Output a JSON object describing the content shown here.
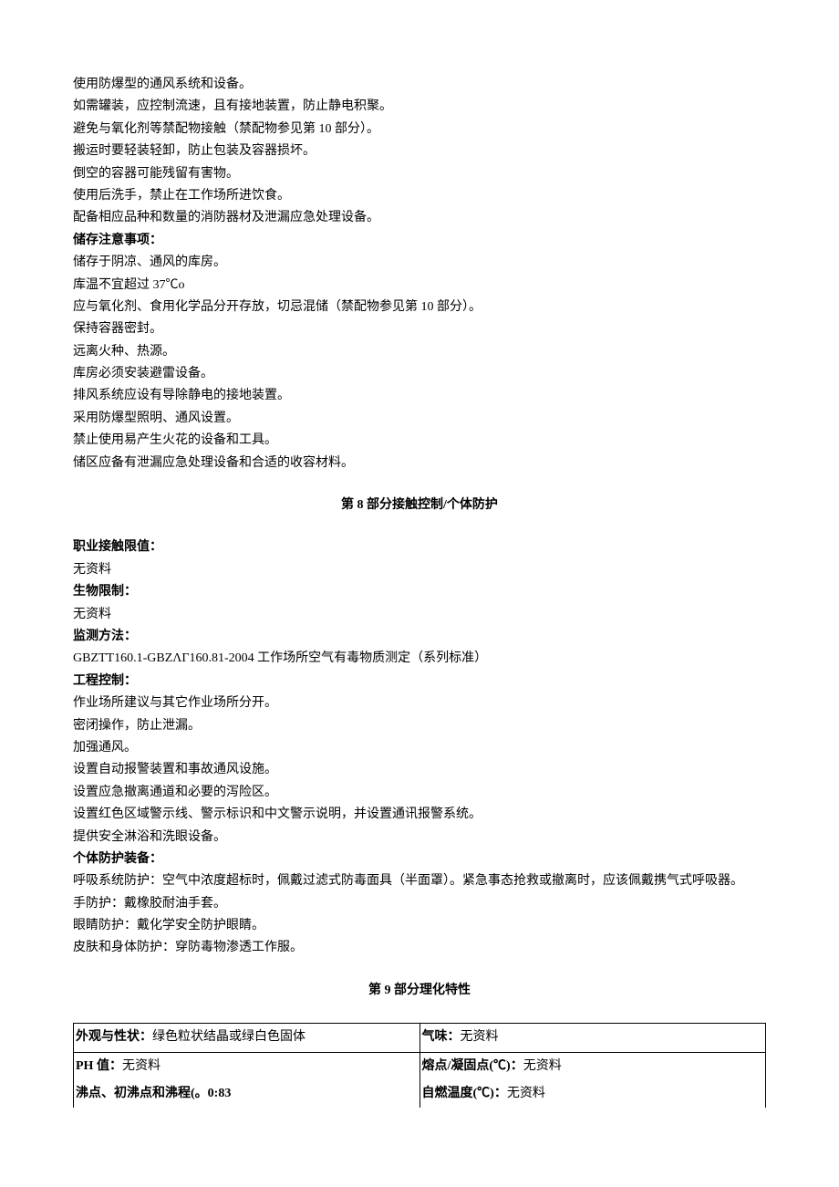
{
  "handling": {
    "lines": [
      "使用防爆型的通风系统和设备。",
      "如需罐装，应控制流速，且有接地装置，防止静电积聚。",
      "避免与氧化剂等禁配物接触（禁配物参见第 10 部分）。",
      "搬运时要轻装轻卸，防止包装及容器损坏。",
      "倒空的容器可能残留有害物。",
      "使用后洗手，禁止在工作场所进饮食。",
      "配备相应品种和数量的消防器材及泄漏应急处理设备。"
    ]
  },
  "storage": {
    "heading": "储存注意事项：",
    "lines": [
      "储存于阴凉、通风的库房。",
      "库温不宜超过 37℃o",
      "应与氧化剂、食用化学品分开存放，切忌混储（禁配物参见第 10 部分）。",
      "保持容器密封。",
      "远离火种、热源。",
      "库房必须安装避雷设备。",
      "排风系统应设有导除静电的接地装置。",
      "采用防爆型照明、通风设置。",
      "禁止使用易产生火花的设备和工具。",
      "储区应备有泄漏应急处理设备和合适的收容材料。"
    ]
  },
  "section8": {
    "title": "第 8 部分接触控制/个体防护",
    "oexp": {
      "label": "职业接触限值：",
      "value": "无资料"
    },
    "biolimit": {
      "label": "生物限制：",
      "value": "无资料"
    },
    "monitor": {
      "label": "监测方法：",
      "value": "GBZTT160.1-GBZΛГ160.81-2004 工作场所空气有毒物质测定（系列标准）"
    },
    "engctrl": {
      "label": "工程控制：",
      "lines": [
        "作业场所建议与其它作业场所分开。",
        "密闭操作，防止泄漏。",
        "加强通风。",
        "设置自动报警装置和事故通风设施。",
        "设置应急撤离通道和必要的泻险区。",
        "设置红色区域警示线、警示标识和中文警示说明，并设置通讯报警系统。",
        "提供安全淋浴和洗眼设备。"
      ]
    },
    "ppe": {
      "label": "个体防护装备：",
      "lines": [
        "呼吸系统防护：空气中浓度超标时，佩戴过滤式防毒面具（半面罩）。紧急事态抢救或撤离时，应该佩戴携气式呼吸器。",
        "手防护：戴橡胶耐油手套。",
        "眼睛防护：戴化学安全防护眼睛。",
        "皮肤和身体防护：穿防毒物渗透工作服。"
      ]
    }
  },
  "section9": {
    "title": "第 9 部分理化特性",
    "rows": [
      {
        "l_label": "外观与性状：",
        "l_value": "绿色粒状结晶或绿白色固体",
        "r_label": "气味：",
        "r_value": "无资料"
      },
      {
        "l_label": "PH 值：",
        "l_value": "无资料",
        "r_label": "熔点/凝固点(℃)：",
        "r_value": "无资料"
      },
      {
        "l_label": "沸点、初沸点和沸程(。0:83",
        "l_value": "",
        "r_label": "自燃温度(℃)：",
        "r_value": "无资料"
      }
    ]
  }
}
